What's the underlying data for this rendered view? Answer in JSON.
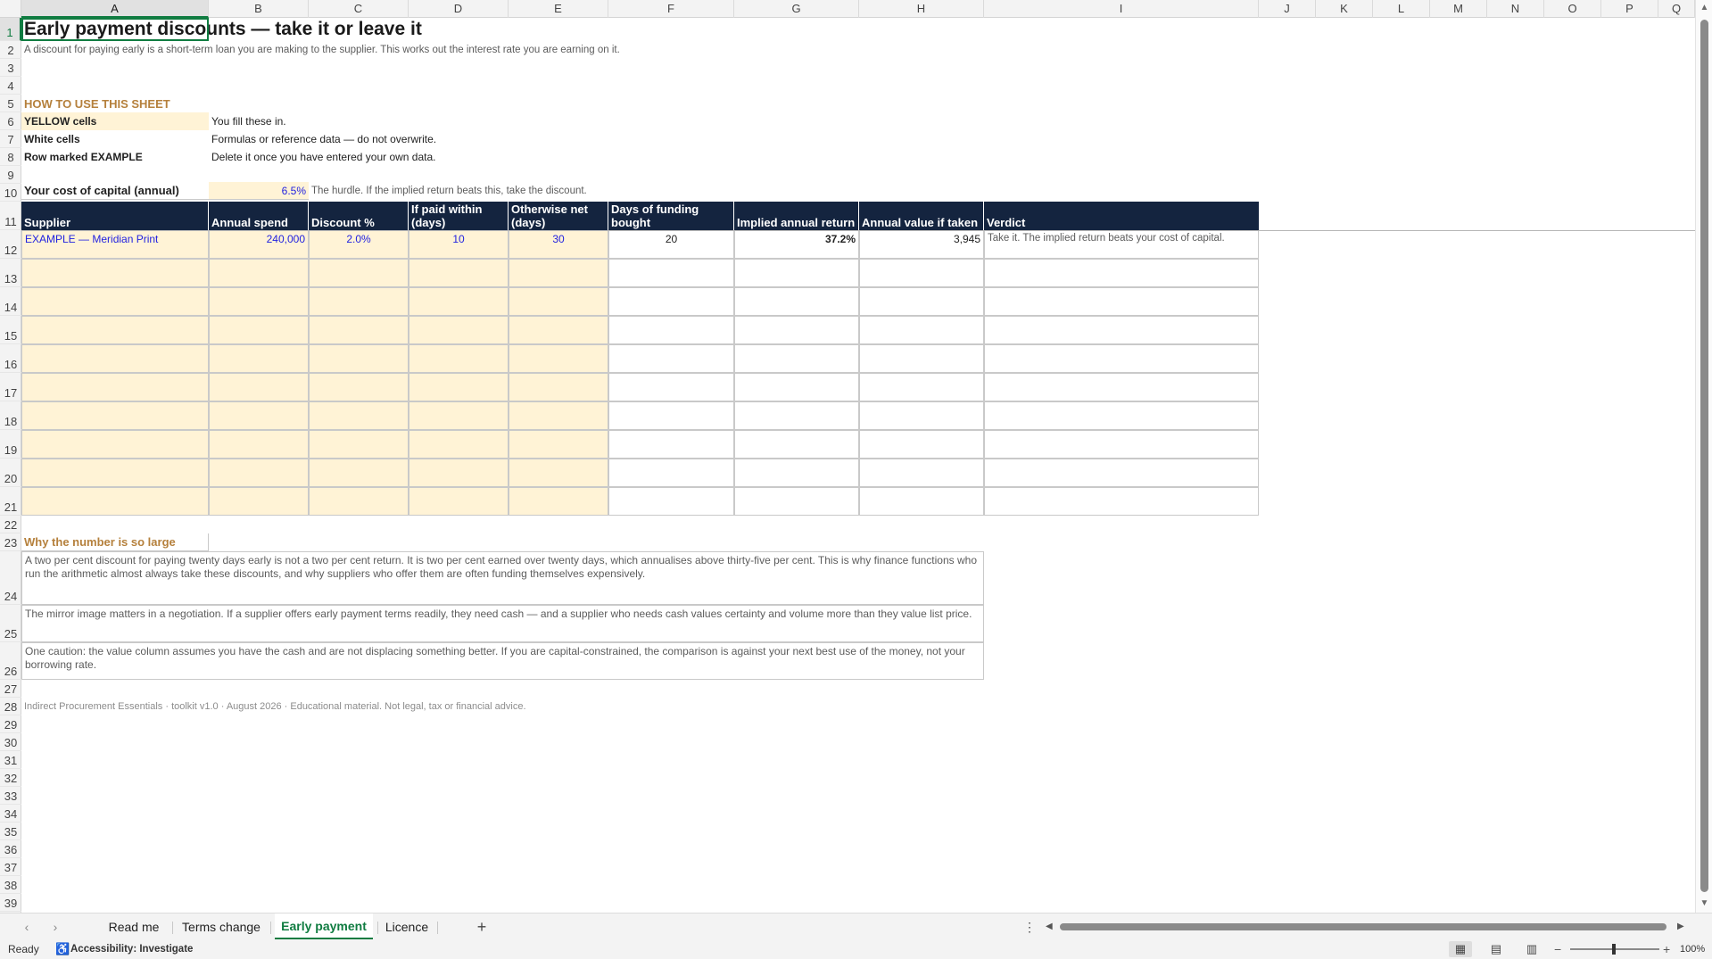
{
  "columns": [
    "A",
    "B",
    "C",
    "D",
    "E",
    "F",
    "G",
    "H",
    "I",
    "J",
    "K",
    "L",
    "M",
    "N",
    "O",
    "P",
    "Q"
  ],
  "rows": [
    "1",
    "2",
    "3",
    "4",
    "5",
    "6",
    "7",
    "8",
    "9",
    "10",
    "11",
    "12",
    "13",
    "14",
    "15",
    "16",
    "17",
    "18",
    "19",
    "20",
    "21",
    "22",
    "23",
    "24",
    "25",
    "26",
    "27",
    "28",
    "29",
    "30",
    "31",
    "32",
    "33",
    "34",
    "35",
    "36",
    "37",
    "38",
    "39"
  ],
  "sheet": {
    "title": "Early payment discounts — take it or leave it",
    "subtitle": "A discount for paying early is a short-term loan you are making to the supplier. This works out the interest rate you are earning on it.",
    "howto_heading": "HOW TO USE THIS SHEET",
    "howto": [
      {
        "label": "YELLOW cells",
        "text": "You fill these in."
      },
      {
        "label": "White cells",
        "text": "Formulas or reference data — do not overwrite."
      },
      {
        "label": "Row marked EXAMPLE",
        "text": "Delete it once you have entered your own data."
      }
    ],
    "cost_label": "Your cost of capital (annual)",
    "cost_value": "6.5%",
    "cost_note": "The hurdle. If the implied return beats this, take the discount.",
    "headers": [
      "Supplier",
      "Annual spend",
      "Discount %",
      "If paid within (days)",
      "Otherwise net (days)",
      "Days of funding bought",
      "Implied annual return",
      "Annual value if taken",
      "Verdict"
    ],
    "example_row": {
      "supplier": "EXAMPLE — Meridian Print",
      "spend": "240,000",
      "discount": "2.0%",
      "paid_within": "10",
      "net": "30",
      "days_bought": "20",
      "implied_return": "37.2%",
      "annual_value": "3,945",
      "verdict": "Take it. The implied return beats your cost of capital."
    },
    "why_heading": "Why the number is so large",
    "why_paragraphs": [
      "A two per cent discount for paying twenty days early is not a two per cent return. It is two per cent earned over twenty days, which annualises above thirty-five per cent. This is why finance functions who run the arithmetic almost always take these discounts, and why suppliers who offer them are often funding themselves expensively.",
      "The mirror image matters in a negotiation. If a supplier offers early payment terms readily, they need cash — and a supplier who needs cash values certainty and volume more than they value list price.",
      "One caution: the value column assumes you have the cash and are not displacing something better. If you are capital-constrained, the comparison is against your next best use of the money, not your borrowing rate."
    ],
    "footer": "Indirect Procurement Essentials  ·  toolkit v1.0  ·  August 2026  ·  Educational material. Not legal, tax or financial advice."
  },
  "tabs": {
    "items": [
      "Read me",
      "Terms change",
      "Early payment",
      "Licence"
    ],
    "active": "Early payment",
    "add": "+",
    "more": "⋮"
  },
  "status": {
    "ready": "Ready",
    "accessibility": "Accessibility: Investigate",
    "zoom": "100%"
  },
  "icons": {
    "accessibility": "accessibility-icon",
    "normal_view": "normal-view-icon",
    "page_layout": "page-layout-icon",
    "page_break": "page-break-preview-icon"
  },
  "colors": {
    "header_bg": "#14243f",
    "input_fill": "#fff3d6",
    "input_text": "#1f1fe0",
    "section": "#b5803c",
    "accent": "#107c41"
  }
}
